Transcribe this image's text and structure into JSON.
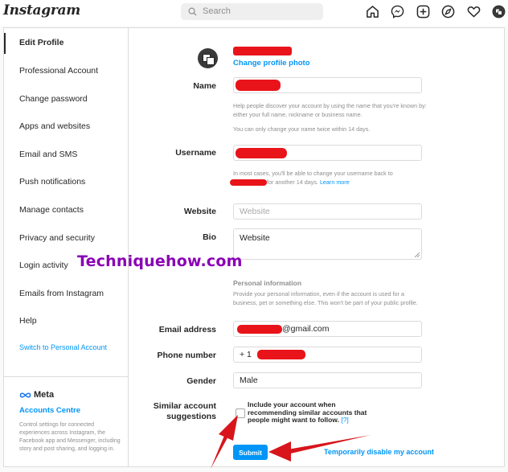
{
  "header": {
    "logo": "Instagram",
    "search_placeholder": "Search",
    "nav_icons": [
      "home-icon",
      "messenger-icon",
      "new-post-icon",
      "explore-icon",
      "activity-heart-icon",
      "profile-avatar-icon"
    ]
  },
  "sidebar": {
    "items": [
      {
        "label": "Edit Profile",
        "active": true
      },
      {
        "label": "Professional Account"
      },
      {
        "label": "Change password"
      },
      {
        "label": "Apps and websites"
      },
      {
        "label": "Email and SMS"
      },
      {
        "label": "Push notifications"
      },
      {
        "label": "Manage contacts"
      },
      {
        "label": "Privacy and security"
      },
      {
        "label": "Login activity"
      },
      {
        "label": "Emails from Instagram"
      },
      {
        "label": "Help"
      }
    ],
    "switch_account": "Switch to Personal Account",
    "meta_brand": "Meta",
    "accounts_centre": "Accounts Centre",
    "accounts_centre_desc": "Control settings for connected experiences across Instagram, the Facebook app and Messenger, including story and post sharing, and logging in."
  },
  "profile": {
    "change_photo": "Change profile photo"
  },
  "form": {
    "name_label": "Name",
    "name_help_1": "Help people discover your account by using the name that you're known by: either your full name, nickname or business name.",
    "name_help_2": "You can only change your name twice within 14 days.",
    "username_label": "Username",
    "username_help_pre": "In most cases, you'll be able to change your username back to",
    "username_help_post": "for another 14 days.",
    "learn_more": "Learn more",
    "website_label": "Website",
    "website_placeholder": "Website",
    "bio_label": "Bio",
    "bio_value": "Website",
    "personal_info_title": "Personal information",
    "personal_info_desc": "Provide your personal information, even if the account is used for a business, pet or something else. This won't be part of your public profile.",
    "email_label": "Email address",
    "email_suffix": "@gmail.com",
    "phone_label": "Phone number",
    "phone_prefix": "+ 1",
    "gender_label": "Gender",
    "gender_value": "Male",
    "similar_label_1": "Similar account",
    "similar_label_2": "suggestions",
    "similar_text": "Include your account when recommending similar accounts that people might want to follow.",
    "similar_help": "[?]",
    "similar_checked": false,
    "submit_label": "Submit",
    "disable_label": "Temporarily disable my account"
  },
  "watermark": "Techniquehow.com",
  "colors": {
    "accent": "#0095f6",
    "redaction": "#e8141a",
    "watermark": "#8b00b5",
    "arrow": "#d7151b"
  }
}
